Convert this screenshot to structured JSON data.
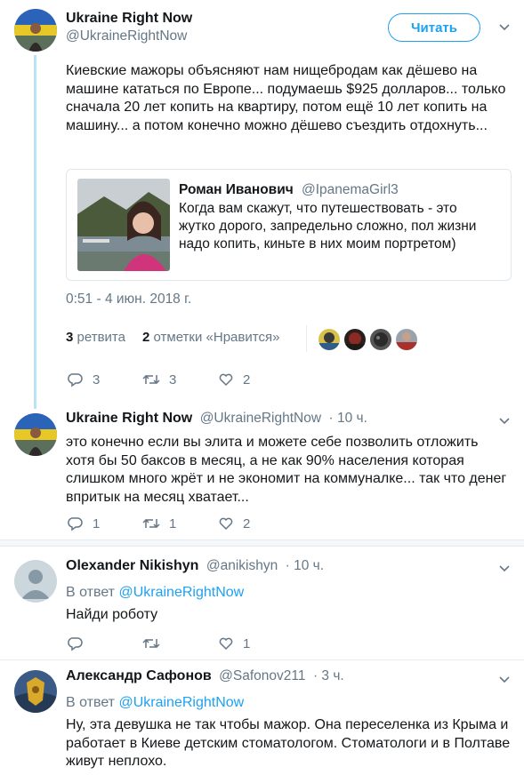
{
  "main_tweet": {
    "name": "Ukraine Right Now",
    "handle": "@UkraineRightNow",
    "follow_label": "Читать",
    "text": "Киевские мажоры объясняют нам нищебродам как дёшево на машине кататься по Европе... подумаешь $925 долларов... только сначала 20 лет копить на квартиру, потом ещё 10 лет копить на машину... а потом конечно можно дёшево съездить отдохнуть...",
    "quote": {
      "name": "Роман Иванович",
      "handle": "@IpanemaGirl3",
      "text": "Когда вам скажут, что путешествовать - это жутко дорого, запредельно сложно, пол жизни надо копить, киньте в них моим портретом)"
    },
    "timestamp": "0:51 - 4 июн. 2018 г.",
    "retweets_count": "3",
    "retweets_label": "ретвита",
    "likes_count": "2",
    "likes_label": "отметки «Нравится»",
    "actions": {
      "reply": "3",
      "retweet": "3",
      "like": "2"
    }
  },
  "replies": [
    {
      "name": "Ukraine Right Now",
      "handle": "@UkraineRightNow",
      "time": "· 10 ч.",
      "reply_to_prefix": "",
      "reply_to": "",
      "text": "это конечно если вы элита и можете себе позволить отложить хотя бы 50 баксов в месяц, а не как 90% населения которая слишком много жрёт и не экономит на коммуналке... так что денег впритык на месяц хватает...",
      "actions": {
        "reply": "1",
        "retweet": "1",
        "like": "2"
      }
    },
    {
      "name": "Olexander Nikishyn",
      "handle": "@anikishyn",
      "time": "· 10 ч.",
      "reply_to_prefix": "В ответ",
      "reply_to": "@UkraineRightNow",
      "text": "Найди роботу",
      "actions": {
        "reply": "",
        "retweet": "",
        "like": "1"
      }
    },
    {
      "name": "Александр Сафонов",
      "handle": "@Safonov211",
      "time": "· 3 ч.",
      "reply_to_prefix": "В ответ",
      "reply_to": "@UkraineRightNow",
      "text": "Ну, эта девушка не так чтобы мажор. Она переселенка из Крыма и работает в Киеве детским стоматологом. Стоматологи и в Полтаве живут неплохо."
    }
  ],
  "colors": {
    "accent": "#1da1f2",
    "muted": "#657786",
    "thread_line": "#b9e3f7"
  },
  "icons": [
    "reply-icon",
    "retweet-icon",
    "like-icon",
    "chevron-down-icon"
  ]
}
